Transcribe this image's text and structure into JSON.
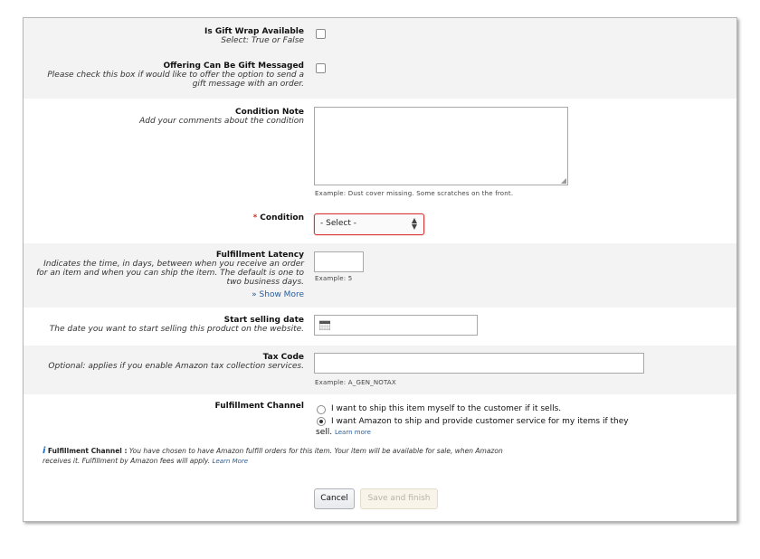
{
  "gift_wrap": {
    "title": "Is Gift Wrap Available",
    "desc": "Select: True or False"
  },
  "gift_message": {
    "title": "Offering Can Be Gift Messaged",
    "desc": "Please check this box if would like to offer the option to send a gift message with an order."
  },
  "condition_note": {
    "title": "Condition Note",
    "desc": "Add your comments about the condition",
    "example": "Example:  Dust cover missing. Some scratches on the front."
  },
  "condition": {
    "required_mark": "*",
    "title": "Condition",
    "selected": "- Select -"
  },
  "fulfillment_latency": {
    "title": "Fulfillment Latency",
    "desc": "Indicates the time, in days, between when you receive an order for an item and when you can ship the item.  The default is one to two business days.",
    "example": "Example:  5",
    "show_more": "Show More",
    "show_more_icon": "double-chevron-down-icon"
  },
  "start_date": {
    "title": "Start selling date",
    "desc": "The date you want to start selling this product on the website."
  },
  "tax_code": {
    "title": "Tax Code",
    "desc": "Optional: applies if you enable Amazon tax collection services.",
    "example": "Example:  A_GEN_NOTAX"
  },
  "fulfillment_channel": {
    "title": "Fulfillment Channel",
    "option_merchant": "I want to ship this item myself to the customer if it sells.",
    "option_amazon_line1": "I want Amazon to ship and provide customer service for my items if they",
    "option_amazon_line2": "sell.",
    "learn_more": "Learn more",
    "selected": "amazon"
  },
  "info": {
    "icon": "info-icon",
    "label": "Fulfillment Channel :",
    "text_line1": "You have chosen to have Amazon fulfill orders for this item. Your item will be available for sale, when Amazon",
    "text_line2": "receives it. Fulfillment by Amazon fees will apply.",
    "learn_more": "Learn More"
  },
  "buttons": {
    "cancel": "Cancel",
    "save": "Save and finish"
  },
  "colors": {
    "required": "#c0392b",
    "link": "#2a5d9a",
    "select_border": "#d63a3a",
    "shade": "#f3f3f3"
  }
}
